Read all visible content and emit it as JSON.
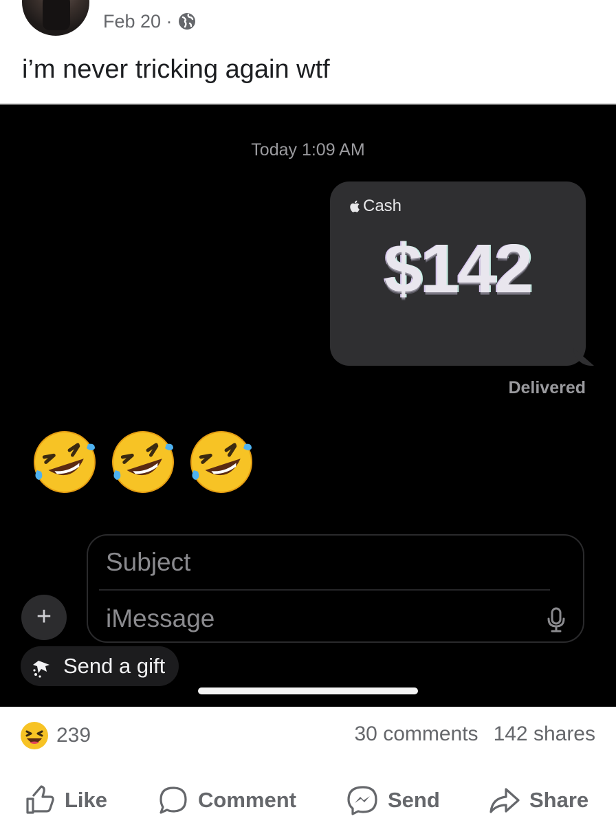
{
  "post": {
    "date": "Feb 20 ·",
    "privacy_icon": "globe-icon",
    "text": "i’m never tricking again wtf"
  },
  "screenshot": {
    "timestamp": "Today 1:09 AM",
    "cash_brand": "Cash",
    "cash_amount": "$142",
    "status": "Delivered",
    "emojis": [
      "rofl-icon",
      "rofl-icon",
      "rofl-icon"
    ],
    "compose": {
      "subject_placeholder": "Subject",
      "message_placeholder": "iMessage"
    },
    "plus_label": "+",
    "gift_label": "Send a gift",
    "colors": {
      "background": "#000000",
      "bubble": "#2f2f31"
    }
  },
  "engagement": {
    "reaction_icon": "haha-icon",
    "reaction_count": "239",
    "comments": "30 comments",
    "shares": "142 shares"
  },
  "actions": {
    "like": "Like",
    "comment": "Comment",
    "send": "Send",
    "share": "Share"
  }
}
